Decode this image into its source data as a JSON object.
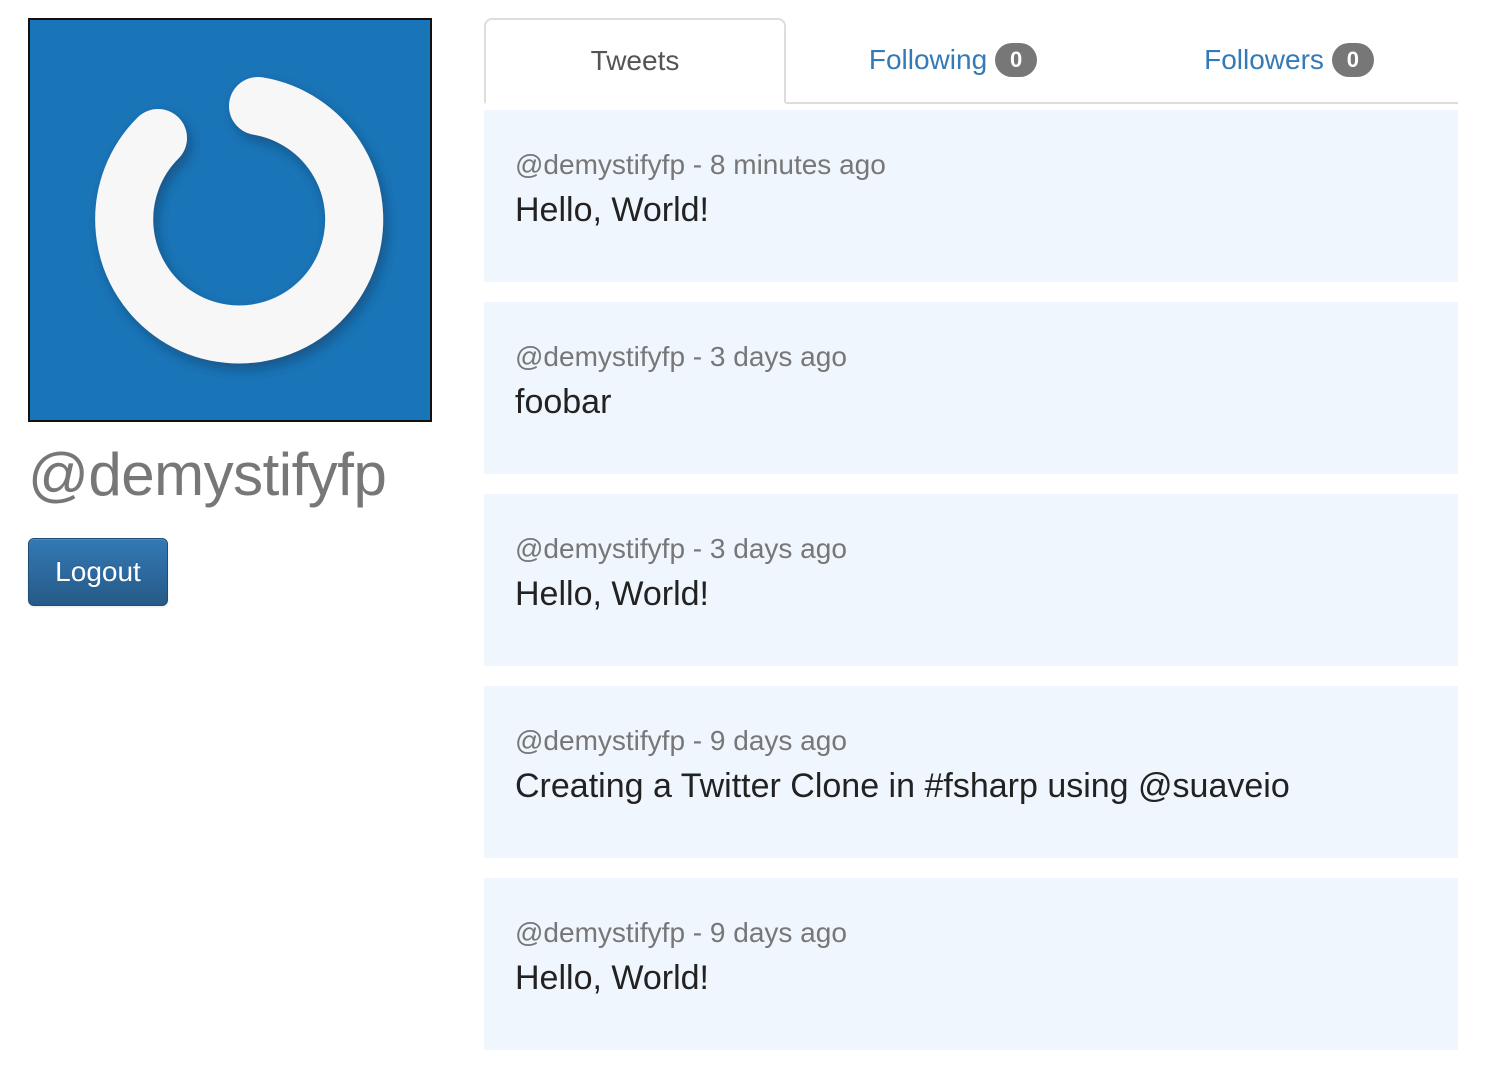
{
  "profile": {
    "username": "@demystifyfp",
    "logout_label": "Logout",
    "avatar_icon": "power-logo-icon",
    "avatar_bg": "#1a75b8"
  },
  "tabs": [
    {
      "label": "Tweets",
      "active": true
    },
    {
      "label": "Following",
      "count": "0",
      "active": false
    },
    {
      "label": "Followers",
      "count": "0",
      "active": false
    }
  ],
  "tweets": [
    {
      "meta": "@demystifyfp - 8 minutes ago",
      "text": "Hello, World!"
    },
    {
      "meta": "@demystifyfp - 3 days ago",
      "text": "foobar"
    },
    {
      "meta": "@demystifyfp - 3 days ago",
      "text": "Hello, World!"
    },
    {
      "meta": "@demystifyfp - 9 days ago",
      "text": "Creating a Twitter Clone in #fsharp using @suaveio"
    },
    {
      "meta": "@demystifyfp - 9 days ago",
      "text": "Hello, World!"
    }
  ],
  "colors": {
    "link": "#337ab7",
    "tweet_bg": "#eff6fe",
    "badge_bg": "#777777",
    "button_bg": "#2e6da4"
  }
}
